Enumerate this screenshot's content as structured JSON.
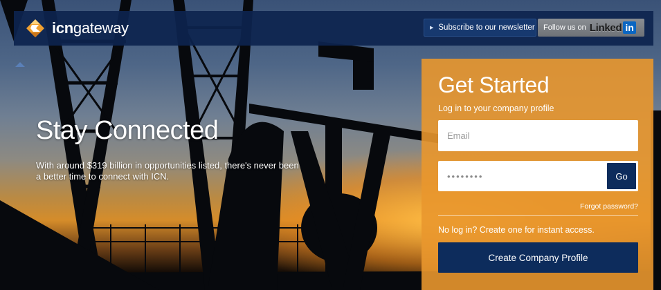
{
  "brand": {
    "logo_icon": "icn-diamond-logo-icon",
    "name_bold": "icn",
    "name_light": "gateway"
  },
  "header": {
    "subscribe_label": "Subscribe to our newsletter",
    "subscribe_icon": "triangle-right-icon",
    "follow_prefix": "Follow us on",
    "follow_linked": "Linked",
    "follow_in": "in"
  },
  "hero": {
    "title": "Stay Connected",
    "text": "With around $319 billion in opportunities listed, there's never been a better time to connect with ICN."
  },
  "login": {
    "title": "Get Started",
    "subtitle": "Log in to your company profile",
    "email_placeholder": "Email",
    "password_value": "••••••••",
    "go_label": "Go",
    "forgot_label": "Forgot password?",
    "no_login_text": "No log in? Create one for instant access.",
    "create_label": "Create Company Profile"
  },
  "colors": {
    "navy": "#0d2c5c",
    "orange": "#e9972d",
    "linkedin_blue": "#0a66c2"
  }
}
